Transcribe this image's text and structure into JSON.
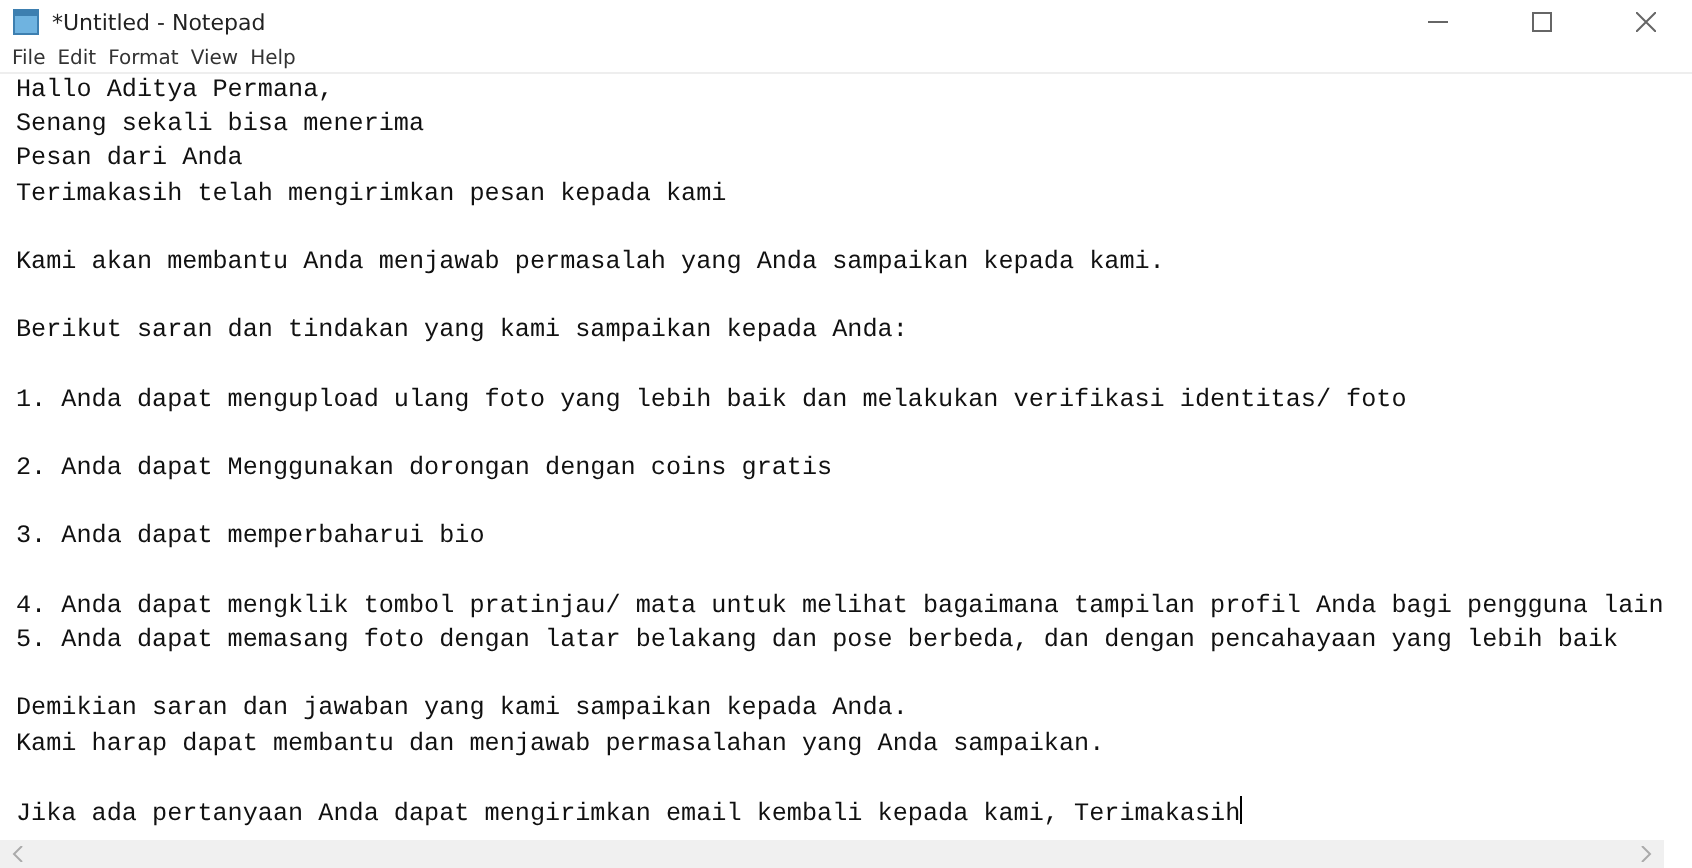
{
  "window": {
    "title": "*Untitled - Notepad"
  },
  "menu": [
    "File",
    "Edit",
    "Format",
    "View",
    "Help"
  ],
  "paragraphs": [
    [
      "Hallo Aditya Permana,",
      "Senang sekali bisa menerima",
      "Pesan dari Anda",
      "Terimakasih telah mengirimkan pesan kepada kami"
    ],
    [
      "Kami akan membantu Anda menjawab permasalah yang Anda sampaikan kepada kami."
    ],
    [
      "Berikut saran dan tindakan yang kami sampaikan kepada Anda:"
    ],
    [
      "1. Anda dapat mengupload ulang foto yang lebih baik dan melakukan verifikasi identitas/ foto"
    ],
    [
      "2. Anda dapat Menggunakan dorongan dengan coins gratis"
    ],
    [
      "3. Anda dapat memperbaharui bio"
    ],
    [
      "4. Anda dapat mengklik tombol pratinjau/ mata untuk melihat bagaimana tampilan profil Anda bagi pengguna lain",
      "5. Anda dapat memasang foto dengan latar belakang dan pose berbeda, dan dengan pencahayaan yang lebih baik"
    ],
    [
      "Demikian saran dan jawaban yang kami sampaikan kepada Anda.",
      "Kami harap dapat membantu dan menjawab permasalahan yang Anda sampaikan."
    ],
    [
      "Jika ada pertanyaan Anda dapat mengirimkan email kembali kepada kami, Terimakasih"
    ]
  ]
}
